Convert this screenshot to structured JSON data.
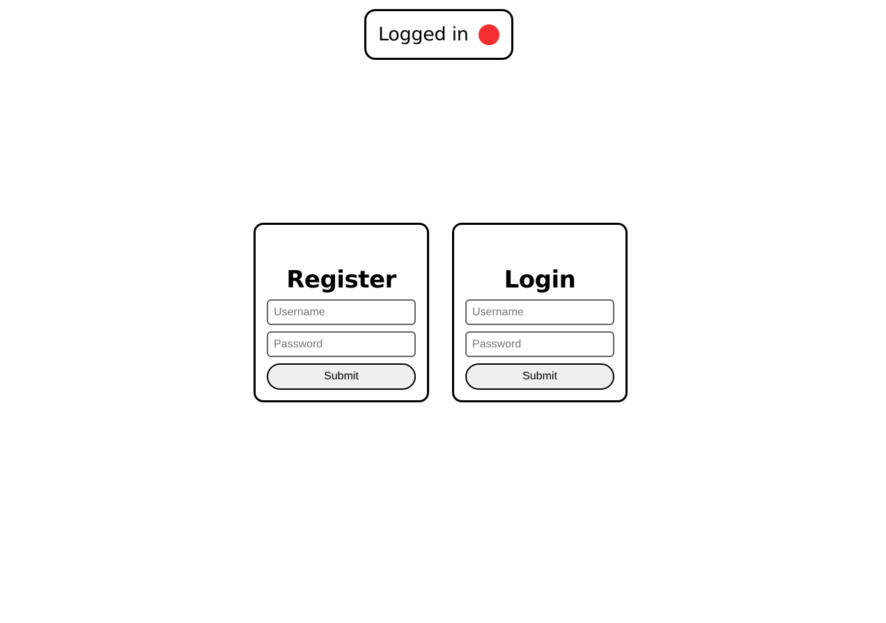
{
  "status": {
    "label": "Logged in",
    "indicator_color": "#f52f2f",
    "indicator_icon": "status-dot-icon"
  },
  "register": {
    "title": "Register",
    "username_placeholder": "Username",
    "password_placeholder": "Password",
    "username_value": "",
    "password_value": "",
    "submit_label": "Submit"
  },
  "login": {
    "title": "Login",
    "username_placeholder": "Username",
    "password_placeholder": "Password",
    "username_value": "",
    "password_value": "",
    "submit_label": "Submit"
  }
}
